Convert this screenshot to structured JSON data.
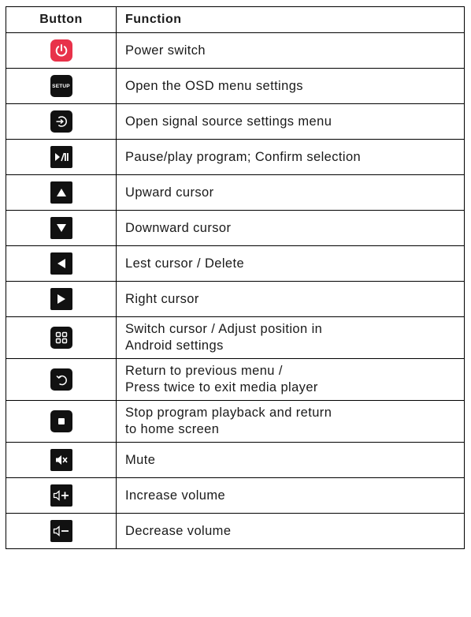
{
  "header": {
    "button": "Button",
    "function": "Function"
  },
  "rows": [
    {
      "icon": "power-icon",
      "text": [
        "Power switch"
      ]
    },
    {
      "icon": "setup-icon",
      "icon_label": "SETUP",
      "text": [
        "Open the OSD menu settings"
      ]
    },
    {
      "icon": "input-source-icon",
      "text": [
        "Open signal source settings menu"
      ]
    },
    {
      "icon": "play-pause-icon",
      "text": [
        "Pause/play program; Confirm selection"
      ]
    },
    {
      "icon": "up-arrow-icon",
      "text": [
        "Upward cursor"
      ]
    },
    {
      "icon": "down-arrow-icon",
      "text": [
        "Downward cursor"
      ]
    },
    {
      "icon": "left-arrow-icon",
      "text": [
        "Lest cursor / Delete"
      ]
    },
    {
      "icon": "right-arrow-icon",
      "text": [
        "Right cursor"
      ]
    },
    {
      "icon": "apps-grid-icon",
      "text": [
        "Switch cursor / Adjust position in",
        "Android settings"
      ]
    },
    {
      "icon": "back-icon",
      "text": [
        "Return to previous menu /",
        "Press twice to exit media player"
      ]
    },
    {
      "icon": "stop-icon",
      "text": [
        "Stop program playback and return",
        "to home screen"
      ]
    },
    {
      "icon": "mute-icon",
      "text": [
        "Mute"
      ]
    },
    {
      "icon": "volume-up-icon",
      "text": [
        "Increase volume"
      ]
    },
    {
      "icon": "volume-down-icon",
      "text": [
        "Decrease volume"
      ]
    }
  ],
  "colors": {
    "power_button": "#e8324a",
    "icon_background": "#111111",
    "border": "#000000"
  }
}
